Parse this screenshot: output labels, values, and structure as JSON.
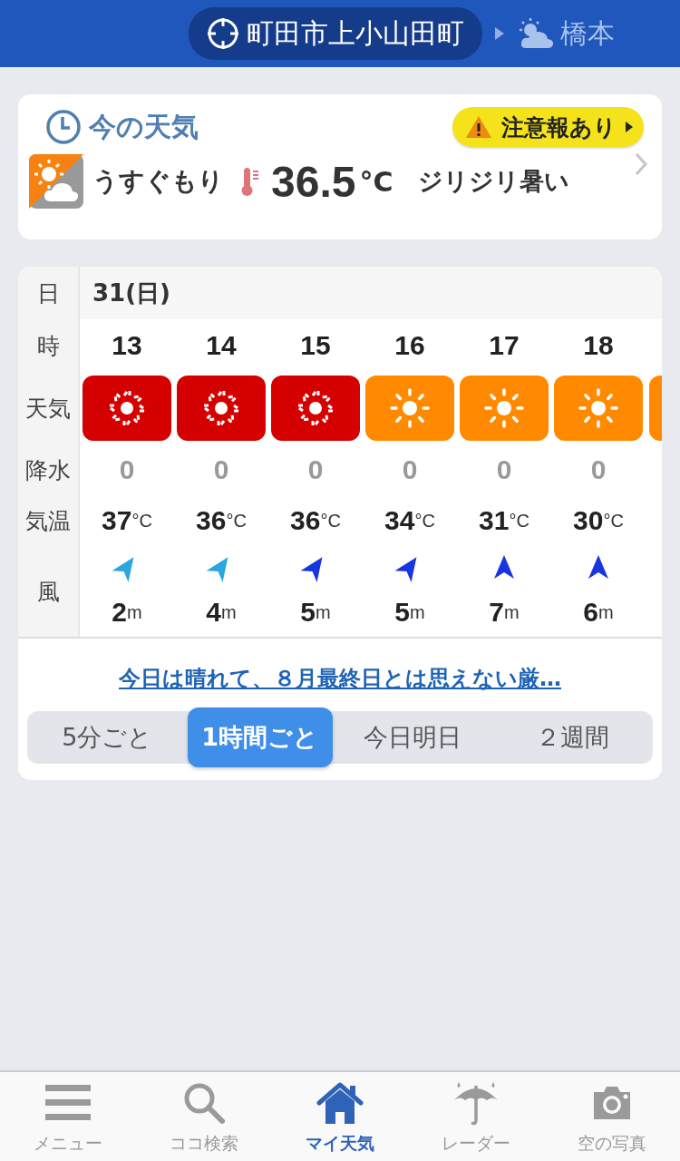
{
  "header": {
    "location": "町田市上小山田町",
    "next_location": "橋本"
  },
  "now": {
    "title": "今の天気",
    "warning": "注意報あり",
    "condition": "うすぐもり",
    "temperature": "36.5",
    "unit": "°C",
    "comment": "ジリジリ暑い"
  },
  "forecast": {
    "date_label": "日",
    "date": "31(日)",
    "row_labels": [
      "時",
      "天気",
      "降水",
      "気温",
      "風"
    ],
    "hours": [
      {
        "hour": "13",
        "kind": "extreme-heat",
        "color": "#d50000",
        "precipitation": "0",
        "temperature": "37",
        "temperature_unit": "°C",
        "wind_arrow": {
          "kind": "northeast",
          "color": "#2aa7e1"
        },
        "wind": "2",
        "wind_unit": "m"
      },
      {
        "hour": "14",
        "kind": "extreme-heat",
        "color": "#d50000",
        "precipitation": "0",
        "temperature": "36",
        "temperature_unit": "°C",
        "wind_arrow": {
          "kind": "northeast",
          "color": "#2aa7e1"
        },
        "wind": "4",
        "wind_unit": "m"
      },
      {
        "hour": "15",
        "kind": "extreme-heat",
        "color": "#d50000",
        "precipitation": "0",
        "temperature": "36",
        "temperature_unit": "°C",
        "wind_arrow": {
          "kind": "northeast",
          "color": "#1836e0"
        },
        "wind": "5",
        "wind_unit": "m"
      },
      {
        "hour": "16",
        "kind": "sunny",
        "color": "#ff8a00",
        "precipitation": "0",
        "temperature": "34",
        "temperature_unit": "°C",
        "wind_arrow": {
          "kind": "northeast",
          "color": "#1836e0"
        },
        "wind": "5",
        "wind_unit": "m"
      },
      {
        "hour": "17",
        "kind": "sunny",
        "color": "#ff8a00",
        "precipitation": "0",
        "temperature": "31",
        "temperature_unit": "°C",
        "wind_arrow": {
          "kind": "north",
          "color": "#1836e0"
        },
        "wind": "7",
        "wind_unit": "m"
      },
      {
        "hour": "18",
        "kind": "sunny",
        "color": "#ff8a00",
        "precipitation": "0",
        "temperature": "30",
        "temperature_unit": "°C",
        "wind_arrow": {
          "kind": "north",
          "color": "#1836e0"
        },
        "wind": "6",
        "wind_unit": "m"
      }
    ],
    "next_tile": {
      "color": "#ff8a00"
    }
  },
  "summary_link": "今日は晴れて、８月最終日とは思えない厳…",
  "intervals": [
    {
      "label": "5分ごと",
      "selected": false
    },
    {
      "label": "1時間ごと",
      "selected": true
    },
    {
      "label": "今日明日",
      "selected": false
    },
    {
      "label": "２週間",
      "selected": false
    }
  ],
  "nav": [
    {
      "kind": "menu",
      "label": "メニュー",
      "selected": false
    },
    {
      "kind": "search",
      "label": "ココ検索",
      "selected": false
    },
    {
      "kind": "home",
      "label": "マイ天気",
      "selected": true
    },
    {
      "kind": "radar",
      "label": "レーダー",
      "selected": false
    },
    {
      "kind": "camera",
      "label": "空の写真",
      "selected": false
    }
  ]
}
